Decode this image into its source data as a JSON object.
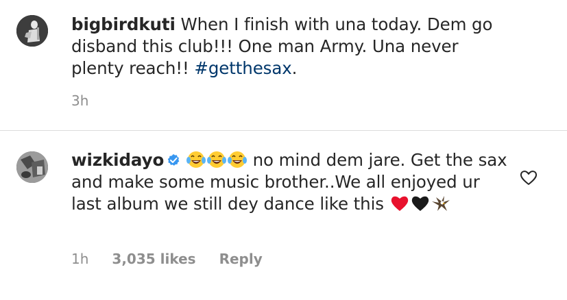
{
  "comments": [
    {
      "username": "bigbirdkuti",
      "text": "When I finish with una today. Dem go disband this club!!! One man Army. Una never plenty reach!! ",
      "hashtag": "#getthesax",
      "trailing": ".",
      "time": "3h"
    },
    {
      "username": "wizkidayo",
      "verified_icon": "verified-badge-icon",
      "emojis": [
        "face-with-tears-of-joy-icon",
        "face-with-tears-of-joy-icon",
        "face-with-tears-of-joy-icon"
      ],
      "text": "no mind dem jare. Get the sax and make some music brother..We all enjoyed ur last album we still dey dance like this",
      "trailing_emojis": [
        "red-heart-icon",
        "black-heart-icon",
        "eagle-icon"
      ],
      "time": "1h",
      "likes": "3,035 likes",
      "reply": "Reply",
      "like_icon": "heart-outline-icon"
    }
  ],
  "colors": {
    "text": "#262626",
    "meta": "#8e8e8e",
    "hashtag": "#00376b",
    "verified": "#3897f0",
    "divider": "#dbdbdb"
  }
}
